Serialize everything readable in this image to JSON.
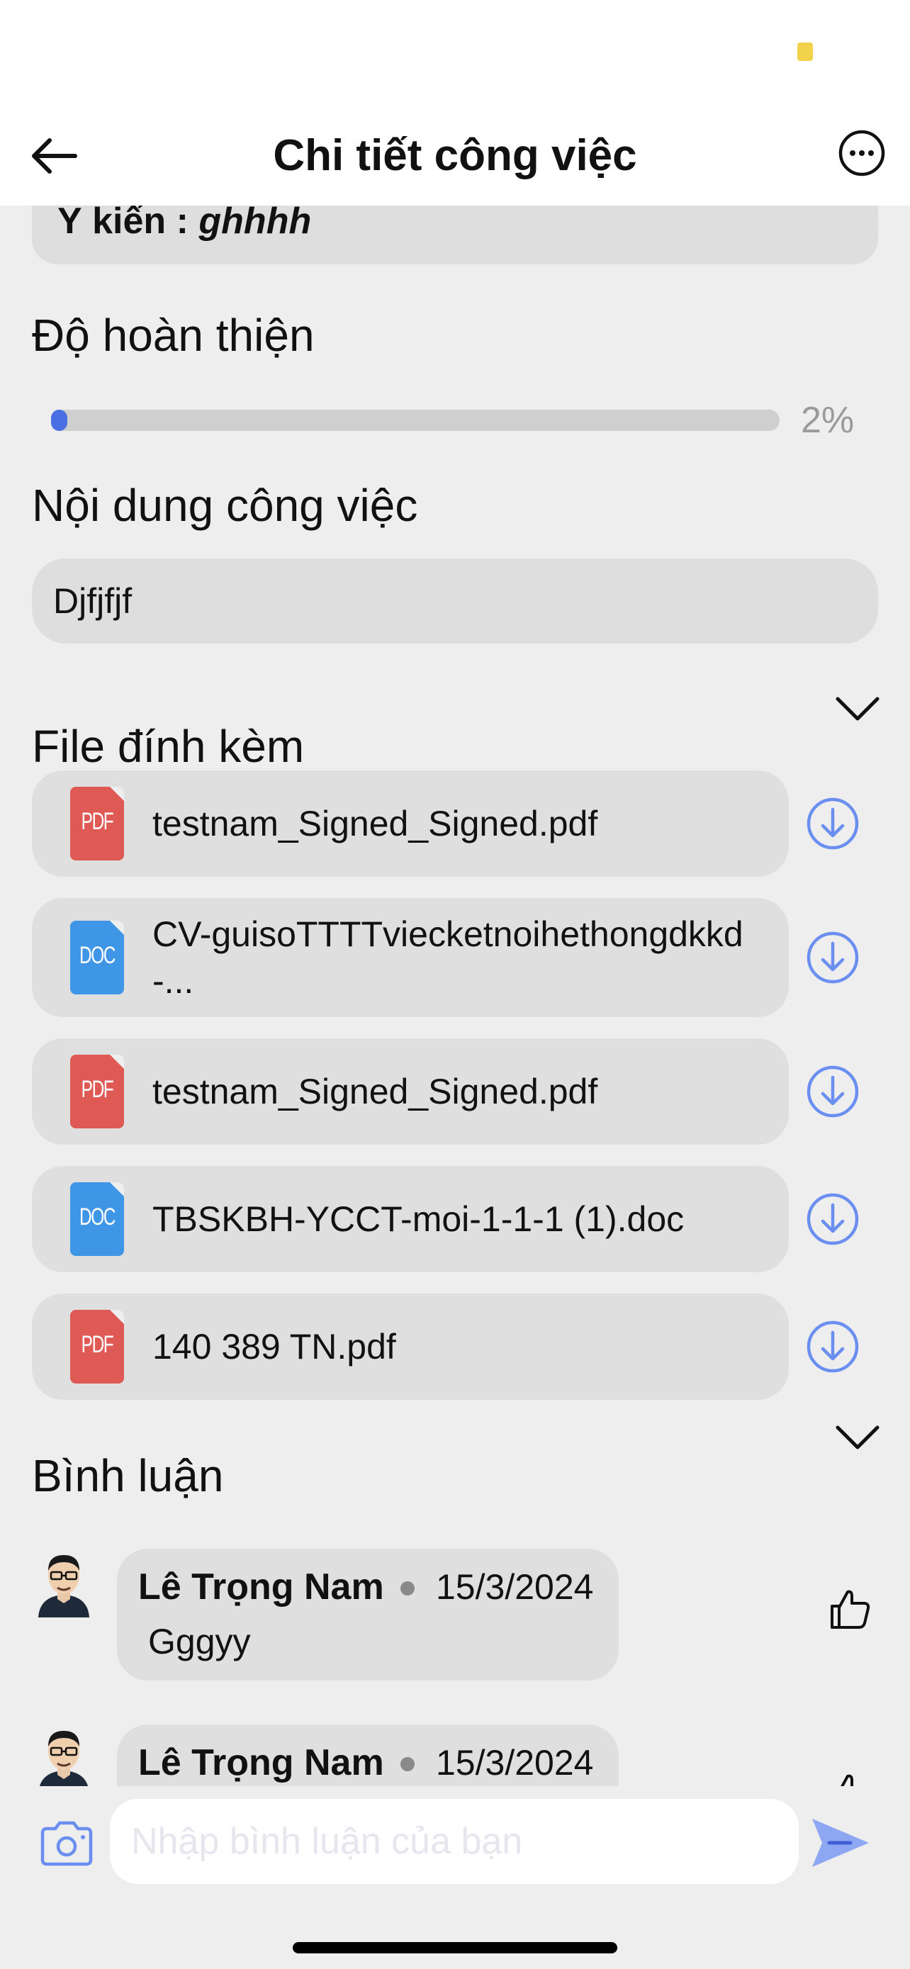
{
  "header": {
    "title": "Chi tiết công việc"
  },
  "opinion": {
    "label": "Ý kiến :",
    "value": "ghhhh"
  },
  "progress": {
    "title": "Độ hoàn thiện",
    "percent": 2,
    "percent_label": "2%",
    "color": "#4a6fe3"
  },
  "task_content": {
    "title": "Nội dung công việc",
    "text": "Djfjfjf"
  },
  "attachments": {
    "title": "File đính kèm",
    "files": [
      {
        "type": "PDF",
        "name": "testnam_Signed_Signed.pdf",
        "color": "#e05a55"
      },
      {
        "type": "DOC",
        "name": "CV-guisoTTTTviecketnoihethongdkkd-...",
        "color": "#3f96e6"
      },
      {
        "type": "PDF",
        "name": "testnam_Signed_Signed.pdf",
        "color": "#e05a55"
      },
      {
        "type": "DOC",
        "name": "TBSKBH-YCCT-moi-1-1-1 (1).doc",
        "color": "#3f96e6"
      },
      {
        "type": "PDF",
        "name": "140 389 TN.pdf",
        "color": "#e05a55"
      }
    ]
  },
  "comments": {
    "title": "Bình luận",
    "items": [
      {
        "author": "Lê Trọng Nam",
        "date": "15/3/2024",
        "text": "Gggyy"
      },
      {
        "author": "Lê Trọng Nam",
        "date": "15/3/2024",
        "text": ""
      }
    ]
  },
  "comment_input": {
    "placeholder": "Nhập bình luận của bạn"
  },
  "icons": {
    "back": "arrow-left-icon",
    "more": "more-horizontal-icon",
    "chevron": "chevron-down-icon",
    "download": "download-circle-icon",
    "like": "thumbs-up-icon",
    "camera": "camera-icon",
    "send": "send-icon",
    "accent": "#6b8ff0"
  }
}
